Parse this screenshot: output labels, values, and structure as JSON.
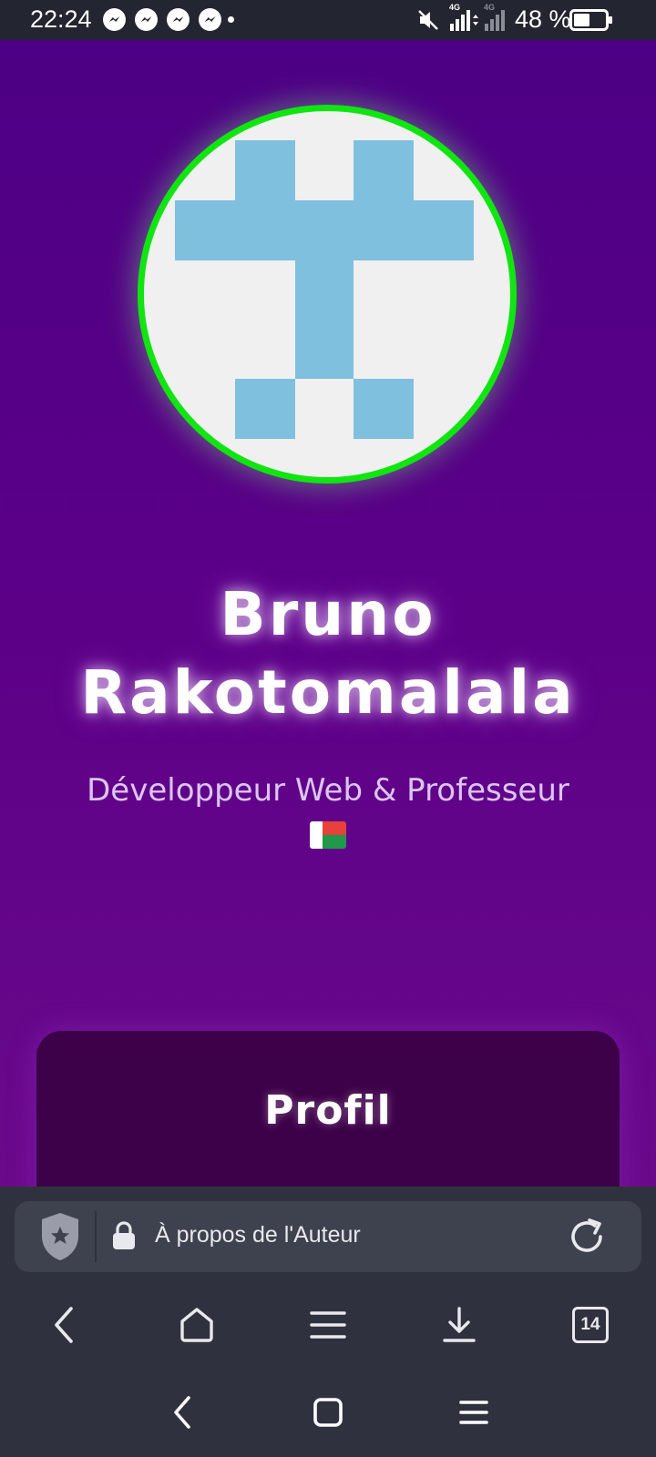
{
  "status_bar": {
    "time": "22:24",
    "battery_percent": "48 %",
    "network_1": "4G",
    "network_2": "4G",
    "notification_icons": [
      "messenger-icon",
      "messenger-icon",
      "messenger-icon",
      "messenger-icon"
    ]
  },
  "page": {
    "author_name_line1": "Bruno",
    "author_name_line2": "Rakotomalala",
    "author_role": "Développeur Web & Professeur",
    "flag_icon": "madagascar-flag-icon",
    "profile_title": "Profil",
    "colors": {
      "background_top": "#4d0085",
      "background_bottom": "#6a0a8a",
      "avatar_ring": "#11e511",
      "avatar_pattern": "#7fc0de",
      "card": "#3d0149"
    }
  },
  "browser": {
    "url_text": "À propos de l'Auteur",
    "tab_count": "14",
    "nav_icons": [
      "back-icon",
      "home-icon",
      "menu-icon",
      "download-icon",
      "tabs-icon"
    ]
  },
  "system_nav": {
    "icons": [
      "back-icon",
      "home-icon",
      "recents-icon"
    ]
  }
}
